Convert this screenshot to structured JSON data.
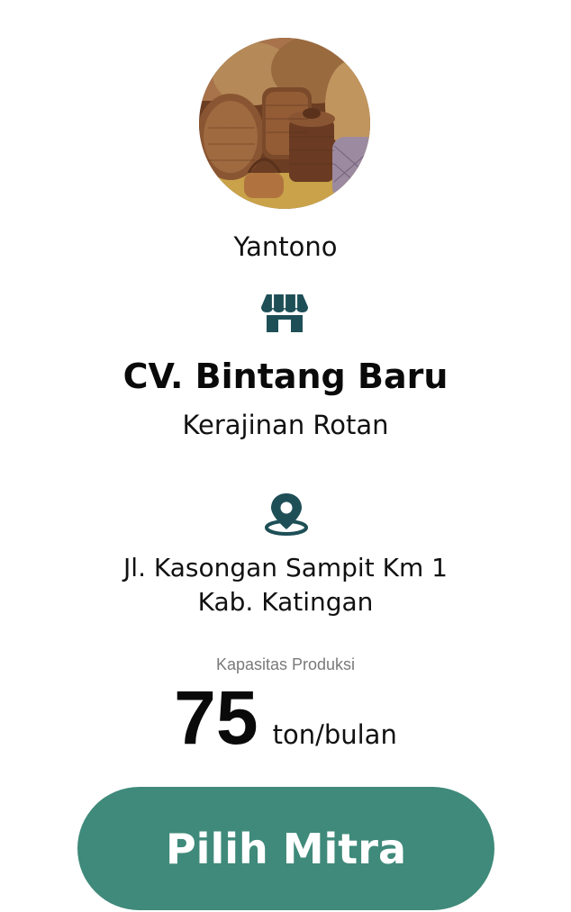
{
  "profile": {
    "owner_name": "Yantono",
    "avatar_alt": "rattan-baskets-photo"
  },
  "store": {
    "icon": "store-icon",
    "company_name": "CV. Bintang Baru",
    "business_type": "Kerajinan Rotan"
  },
  "location": {
    "icon": "location-pin-icon",
    "address_line1": "Jl. Kasongan Sampit Km 1",
    "address_line2": "Kab. Katingan"
  },
  "capacity": {
    "label": "Kapasitas Produksi",
    "value": "75",
    "unit": "ton/bulan"
  },
  "action": {
    "choose_label": "Pilih Mitra"
  },
  "colors": {
    "accent": "#3f8a7a",
    "icon": "#1e4f57",
    "muted_text": "#7a7a7a"
  }
}
